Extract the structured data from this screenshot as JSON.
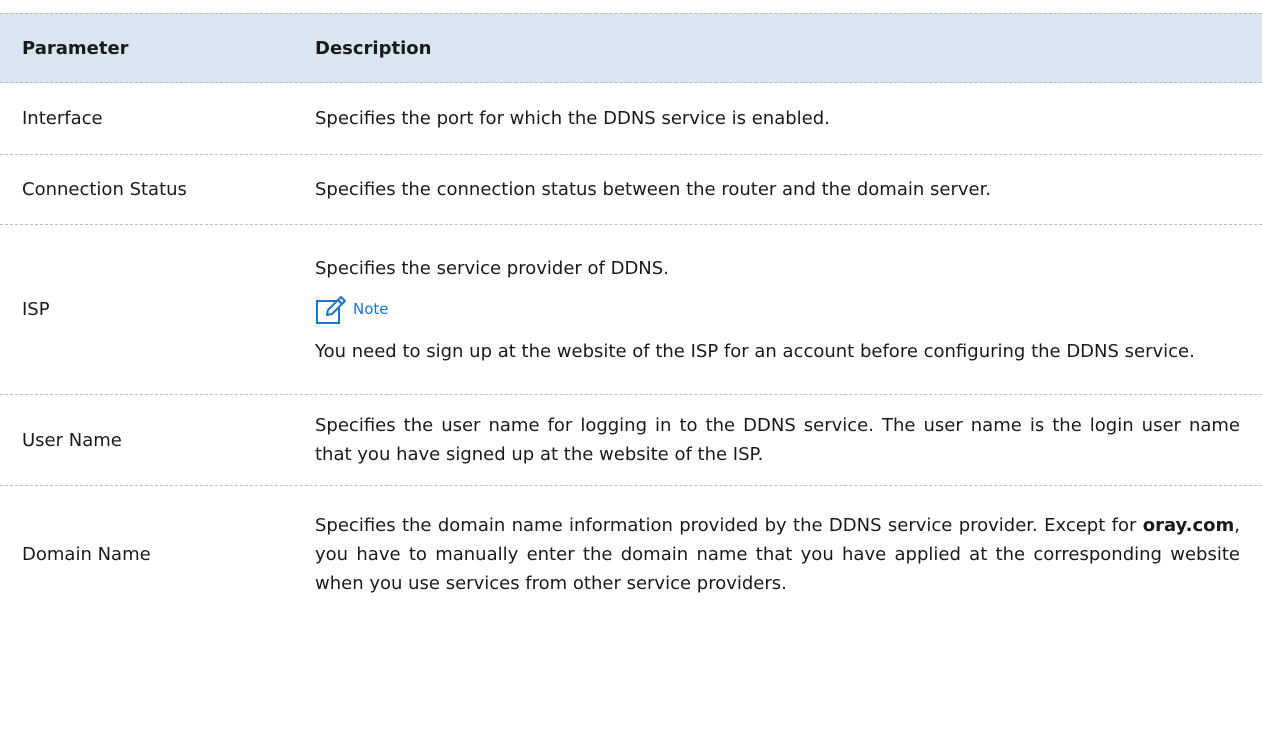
{
  "table": {
    "header": {
      "parameter": "Parameter",
      "description": "Description"
    },
    "rows": [
      {
        "parameter": "Interface",
        "description": "Specifies the port for which the DDNS service is enabled."
      },
      {
        "parameter": "Connection Status",
        "description": "Specifies the connection status between the router and the domain server."
      },
      {
        "parameter": "ISP",
        "description": "Specifies the service provider of DDNS.",
        "note_label": "Note",
        "note_text": "You need to sign up at the website of the ISP for an account before configuring the DDNS service."
      },
      {
        "parameter": "User Name",
        "description": "Specifies the user name for logging in to the DDNS service. The user name is the login user name that you have signed up at the website of the ISP."
      },
      {
        "parameter": "Domain Name",
        "description_part1": "Specifies the domain name information provided by the DDNS service provider. Except for ",
        "description_bold": "oray.com",
        "description_part2": ", you have to manually enter the domain name that you have applied at the corresponding website when you use services from other service providers."
      }
    ]
  },
  "colors": {
    "header_bg": "#dbe5f1",
    "note_accent": "#1a75d2",
    "divider": "#bdbdbd"
  },
  "icons": {
    "note": "note-edit-icon"
  }
}
